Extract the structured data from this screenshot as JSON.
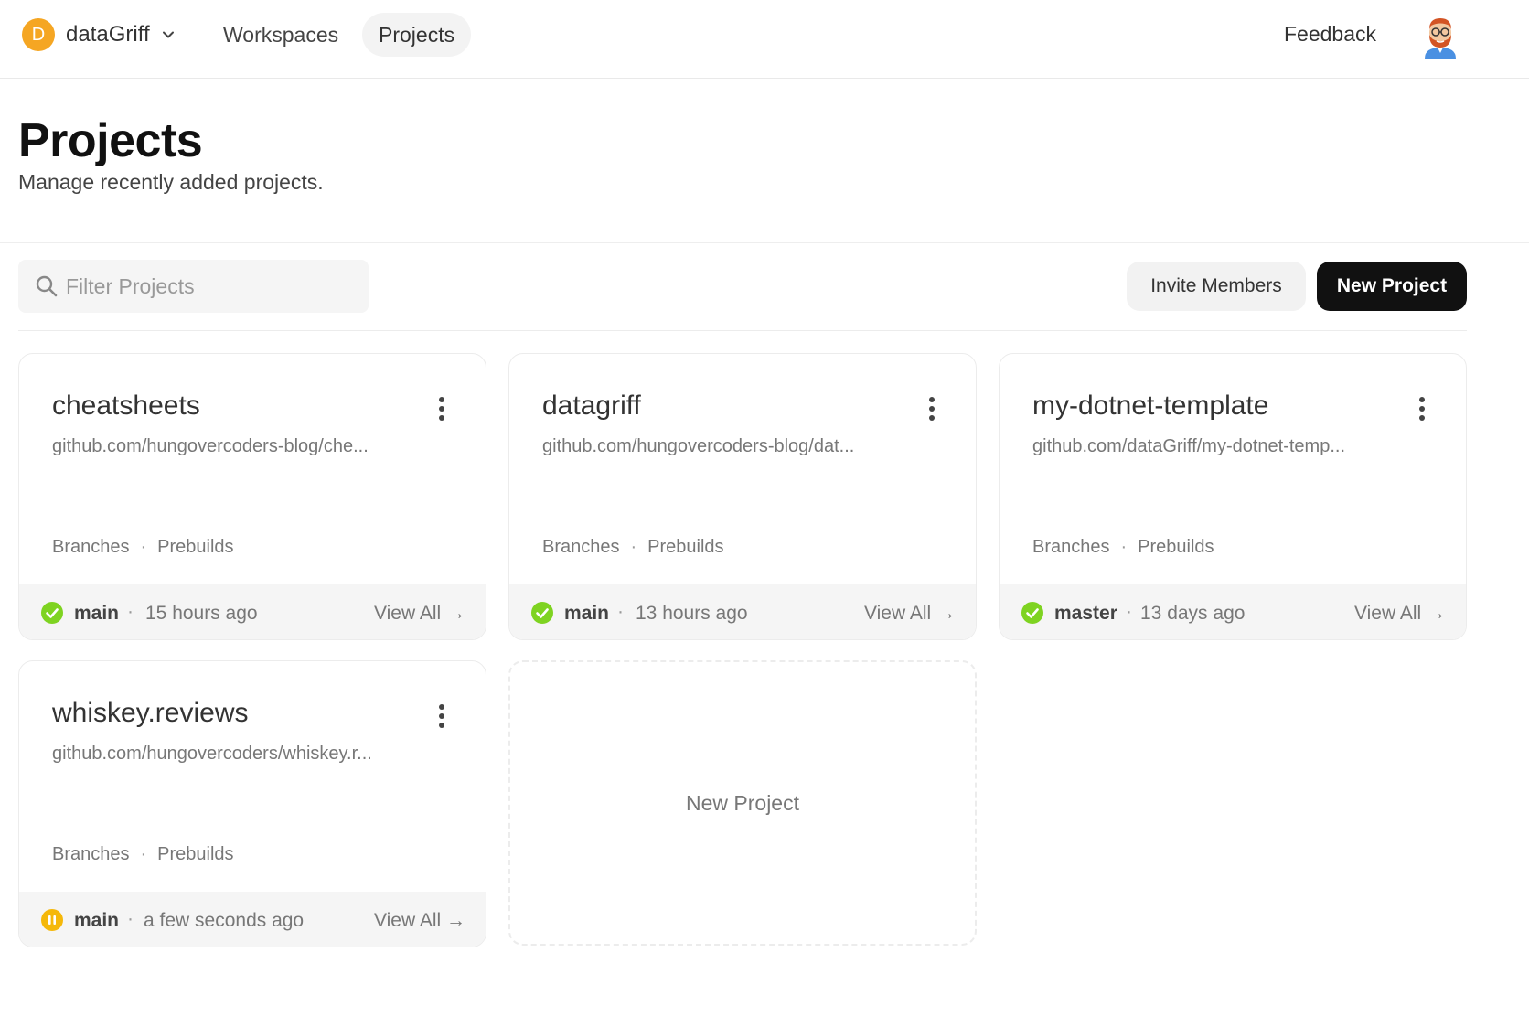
{
  "nav": {
    "org_initial": "D",
    "org_name": "dataGriff",
    "workspaces": "Workspaces",
    "projects": "Projects",
    "feedback": "Feedback"
  },
  "header": {
    "title": "Projects",
    "subtitle": "Manage recently added projects."
  },
  "toolbar": {
    "filter_placeholder": "Filter Projects",
    "invite_label": "Invite Members",
    "new_project_label": "New Project"
  },
  "projects": [
    {
      "name": "cheatsheets",
      "url": "github.com/hungovercoders-blog/che...",
      "branches_label": "Branches",
      "prebuilds_label": "Prebuilds",
      "branch": "main",
      "time": "15 hours ago",
      "status": "success",
      "view_all": "View All →"
    },
    {
      "name": "datagriff",
      "url": "github.com/hungovercoders-blog/dat...",
      "branches_label": "Branches",
      "prebuilds_label": "Prebuilds",
      "branch": "main",
      "time": "13 hours ago",
      "status": "success",
      "view_all": "View All →"
    },
    {
      "name": "my-dotnet-template",
      "url": "github.com/dataGriff/my-dotnet-temp...",
      "branches_label": "Branches",
      "prebuilds_label": "Prebuilds",
      "branch": "master",
      "time": "13 days ago",
      "status": "success",
      "view_all": "View All →"
    },
    {
      "name": "whiskey.reviews",
      "url": "github.com/hungovercoders/whiskey.r...",
      "branches_label": "Branches",
      "prebuilds_label": "Prebuilds",
      "branch": "main",
      "time": "a few seconds ago",
      "status": "paused",
      "view_all": "View All →"
    }
  ],
  "new_project_card": {
    "label": "New Project"
  },
  "colors": {
    "success": "#7ed321",
    "paused": "#f5b80a",
    "org_avatar": "#f5a623",
    "primary_button": "#111111"
  }
}
